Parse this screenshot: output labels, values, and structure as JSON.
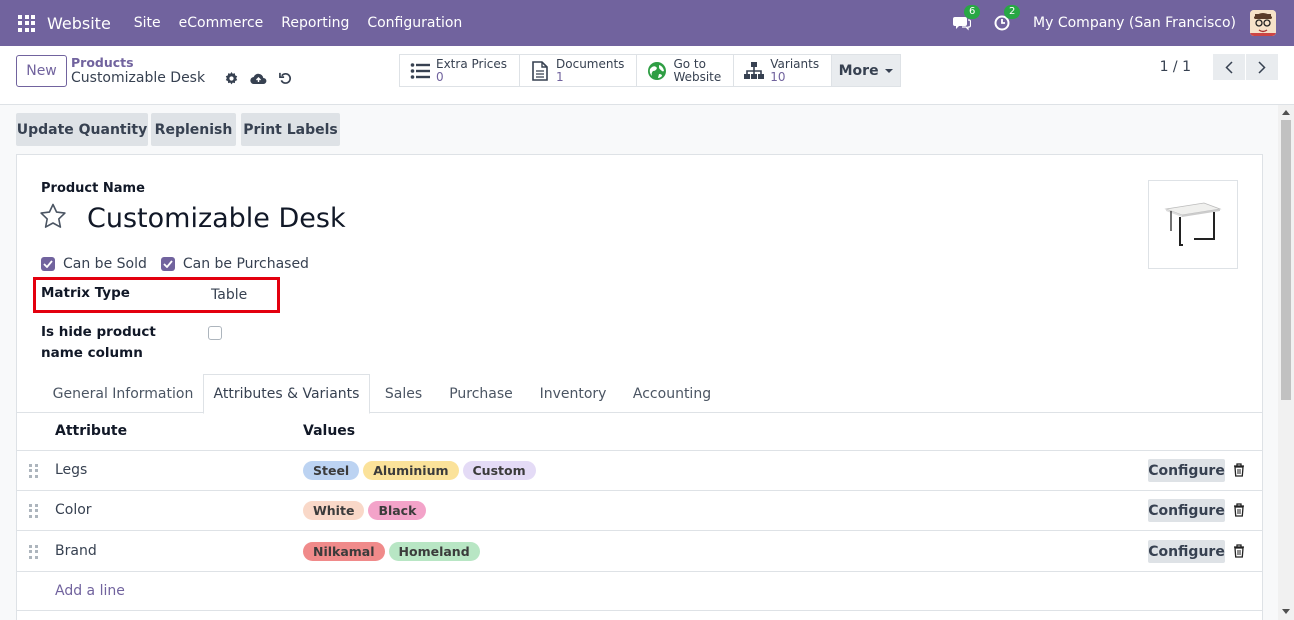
{
  "navbar": {
    "app_name": "Website",
    "menu": [
      "Site",
      "eCommerce",
      "Reporting",
      "Configuration"
    ],
    "messages_count": "6",
    "activities_count": "2",
    "company": "My Company (San Francisco)"
  },
  "control": {
    "new_label": "New",
    "breadcrumb_parent": "Products",
    "breadcrumb_current": "Customizable Desk",
    "smart_buttons": [
      {
        "label": "Extra Prices",
        "value": "0",
        "icon": "list-icon"
      },
      {
        "label": "Documents",
        "value": "1",
        "icon": "document-icon"
      },
      {
        "label": "Go to",
        "value": "Website",
        "icon": "globe-icon"
      },
      {
        "label": "Variants",
        "value": "10",
        "icon": "sitemap-icon"
      }
    ],
    "more_label": "More",
    "pager": "1 / 1"
  },
  "status_buttons": [
    "Update Quantity",
    "Replenish",
    "Print Labels"
  ],
  "form": {
    "product_name_label": "Product Name",
    "product_name": "Customizable Desk",
    "can_be_sold": "Can be Sold",
    "can_be_purchased": "Can be Purchased",
    "matrix_type_label": "Matrix Type",
    "matrix_type_value": "Table",
    "hide_column_label": "Is hide product name column"
  },
  "tabs": [
    "General Information",
    "Attributes & Variants",
    "Sales",
    "Purchase",
    "Inventory",
    "Accounting"
  ],
  "active_tab": "Attributes & Variants",
  "table": {
    "col_attribute": "Attribute",
    "col_values": "Values",
    "configure_label": "Configure",
    "add_line": "Add a line",
    "rows": [
      {
        "attribute": "Legs",
        "values": [
          {
            "name": "Steel",
            "color": "#bcd3f2"
          },
          {
            "name": "Aluminium",
            "color": "#fbe29a"
          },
          {
            "name": "Custom",
            "color": "#e4dbf6"
          }
        ]
      },
      {
        "attribute": "Color",
        "values": [
          {
            "name": "White",
            "color": "#f9d8c8"
          },
          {
            "name": "Black",
            "color": "#f3a3c9"
          }
        ]
      },
      {
        "attribute": "Brand",
        "values": [
          {
            "name": "Nilkamal",
            "color": "#f08a8a"
          },
          {
            "name": "Homeland",
            "color": "#b8e6c4"
          }
        ]
      }
    ]
  },
  "colors": {
    "brand": "#71639e",
    "highlight": "#e3000f"
  }
}
